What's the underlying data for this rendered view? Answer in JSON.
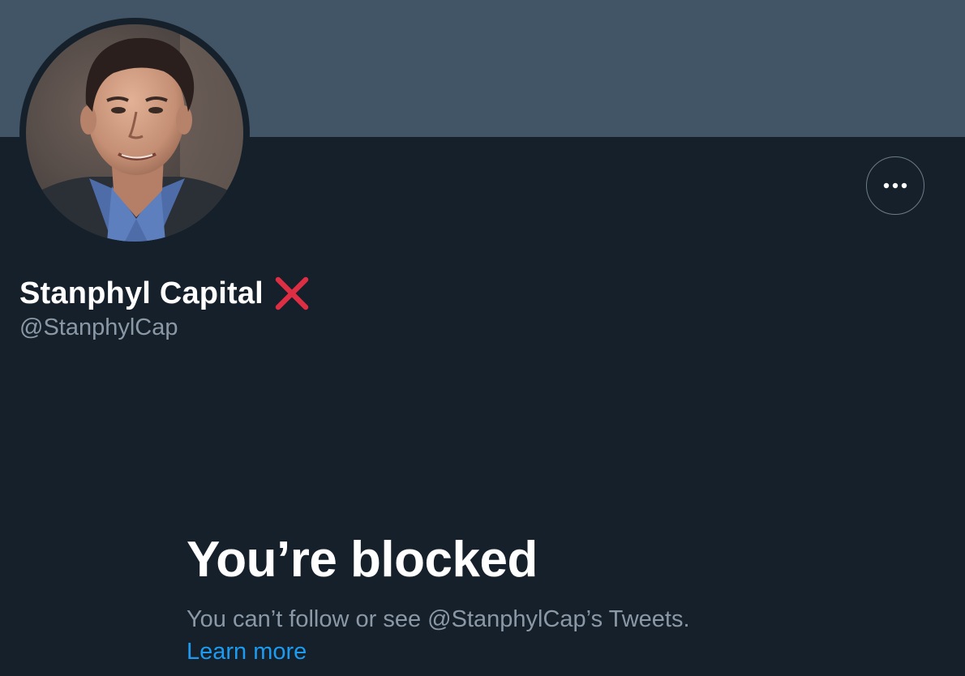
{
  "profile": {
    "display_name": "Stanphyl Capital",
    "name_emoji": "cross-mark-icon",
    "handle": "@StanphylCap",
    "more_button_icon": "more-horizontal-icon"
  },
  "blocked": {
    "title": "You’re blocked",
    "description": "You can’t follow or see @StanphylCap’s Tweets.",
    "learn_more_label": "Learn more"
  },
  "colors": {
    "background": "#15202b",
    "banner": "#425566",
    "secondary_text": "#8b98a5",
    "link": "#1d9bf0",
    "cross_mark": "#dd2e44"
  }
}
